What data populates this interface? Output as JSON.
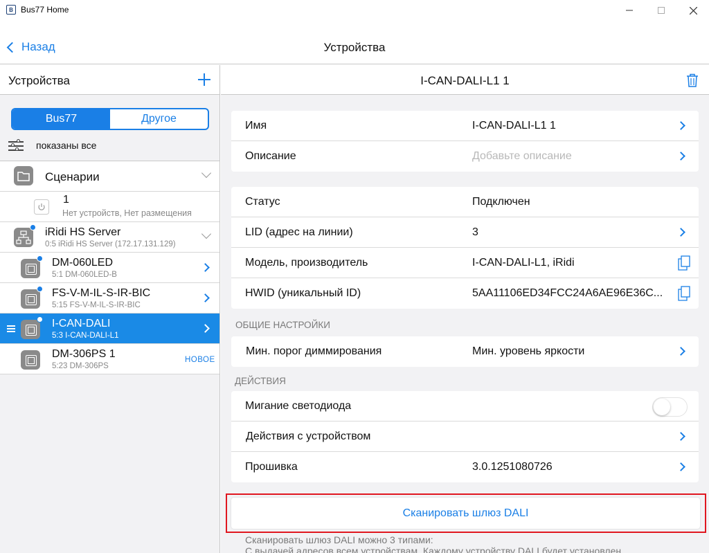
{
  "window": {
    "title": "Bus77 Home",
    "icon_letter": "B"
  },
  "navbar": {
    "back_label": "Назад",
    "title": "Устройства"
  },
  "left": {
    "title": "Устройства",
    "segments": [
      "Bus77",
      "Другое"
    ],
    "filter_text": "показаны все",
    "scenes": {
      "name": "Сценарии"
    },
    "scene_item": {
      "name": "1",
      "sub": "Нет устройств, Нет размещения"
    },
    "server": {
      "name": "iRidi HS Server",
      "sub": "0:5 iRidi HS Server (172.17.131.129)"
    },
    "devices": [
      {
        "name": "DM-060LED",
        "sub": "5:1 DM-060LED-B"
      },
      {
        "name": "FS-V-M-IL-S-IR-BIC",
        "sub": "5:15 FS-V-M-IL-S-IR-BIC"
      },
      {
        "name": "I-CAN-DALI",
        "sub": "5:3 I-CAN-DALI-L1"
      },
      {
        "name": "DM-306PS 1",
        "sub": "5:23 DM-306PS",
        "badge": "НОВОЕ"
      }
    ]
  },
  "right": {
    "title": "I-CAN-DALI-L1 1",
    "group1": [
      {
        "label": "Имя",
        "value": "I-CAN-DALI-L1 1"
      },
      {
        "label": "Описание",
        "placeholder": "Добавьте описание"
      }
    ],
    "group2": [
      {
        "label": "Статус",
        "value": "Подключен"
      },
      {
        "label": "LID (адрес на линии)",
        "value": "3"
      },
      {
        "label": "Модель, производитель",
        "value": "I-CAN-DALI-L1, iRidi"
      },
      {
        "label": "HWID (уникальный ID)",
        "value": "5AA11106ED34FCC24A6AE96E36C..."
      }
    ],
    "section_general": "ОБЩИЕ НАСТРОЙКИ",
    "group3": [
      {
        "label": "Мин. порог диммирования",
        "value": "Мин. уровень яркости"
      }
    ],
    "section_actions": "ДЕЙСТВИЯ",
    "group4": [
      {
        "label": "Мигание светодиода"
      },
      {
        "label": "Действия с устройством"
      },
      {
        "label": "Прошивка",
        "value": "3.0.1251080726"
      }
    ],
    "scan_button": "Сканировать шлюз DALI",
    "footnote_line1": "Сканировать шлюз DALI можно 3 типами:",
    "footnote_line2": "С выдачей адресов всем устройствам. Каждому устройству DALI будет установлен"
  }
}
